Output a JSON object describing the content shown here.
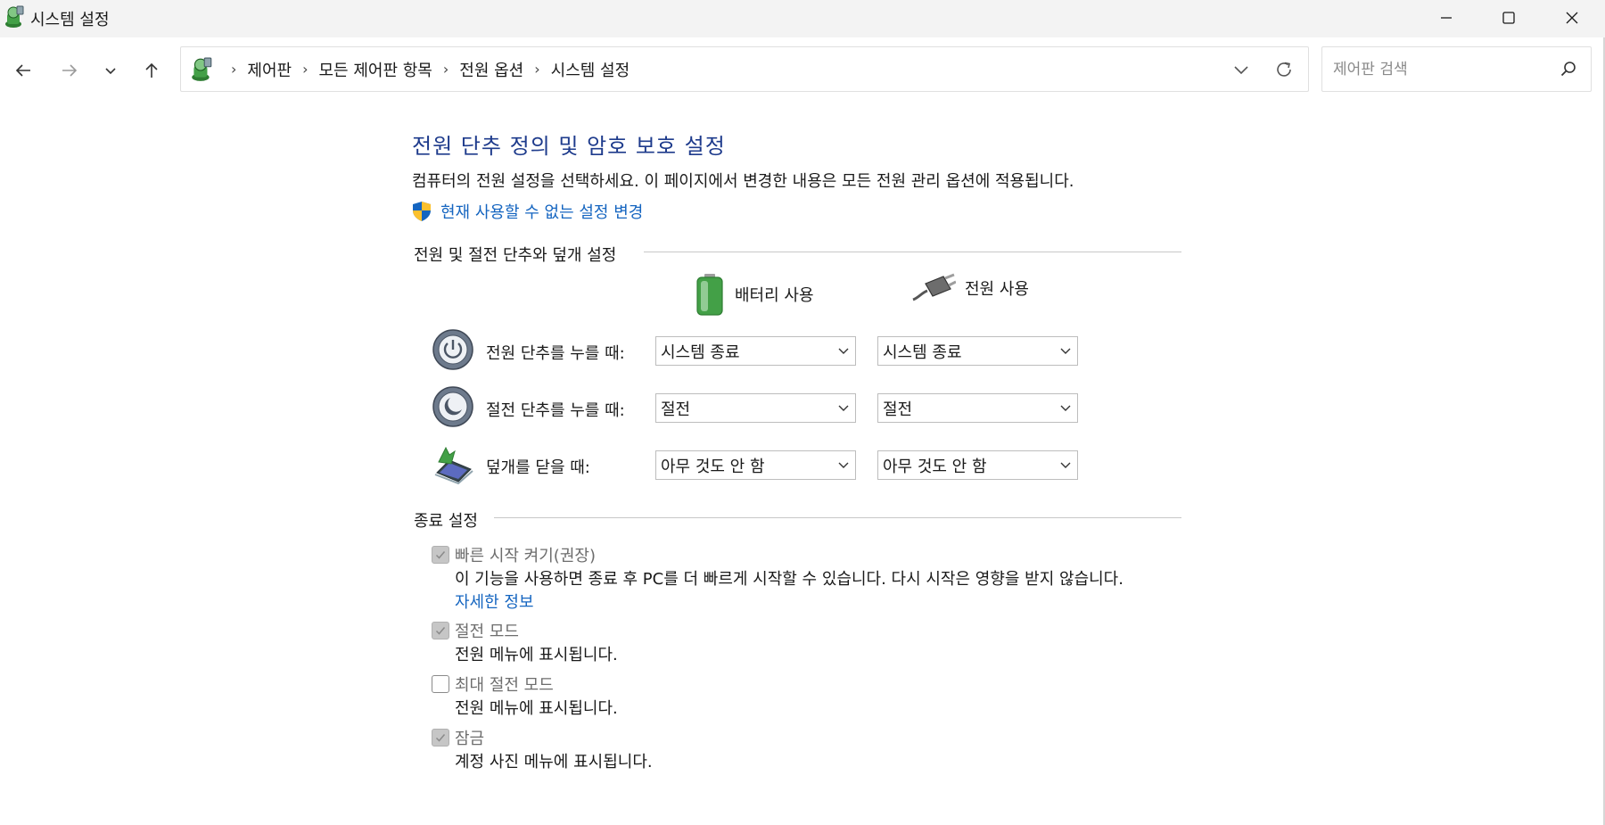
{
  "window": {
    "title": "시스템 설정"
  },
  "breadcrumb": [
    "제어판",
    "모든 제어판 항목",
    "전원 옵션",
    "시스템 설정"
  ],
  "search": {
    "placeholder": "제어판 검색"
  },
  "page": {
    "title": "전원 단추 정의 및 암호 보호 설정",
    "description": "컴퓨터의 전원 설정을 선택하세요. 이 페이지에서 변경한 내용은 모든 전원 관리 옵션에 적용됩니다.",
    "uac_link": "현재 사용할 수 없는 설정 변경"
  },
  "buttons_section": {
    "header": "전원 및 절전 단추와 덮개 설정",
    "col_battery": "배터리 사용",
    "col_plugged": "전원 사용",
    "rows": [
      {
        "label": "전원 단추를 누를 때:",
        "battery": "시스템 종료",
        "plugged": "시스템 종료",
        "icon": "power-button-icon"
      },
      {
        "label": "절전 단추를 누를 때:",
        "battery": "절전",
        "plugged": "절전",
        "icon": "sleep-button-icon"
      },
      {
        "label": "덮개를 닫을 때:",
        "battery": "아무 것도 안 함",
        "plugged": "아무 것도 안 함",
        "icon": "laptop-lid-icon"
      }
    ]
  },
  "shutdown_section": {
    "header": "종료 설정",
    "options": [
      {
        "label": "빠른 시작 켜기(권장)",
        "checked": true,
        "description": "이 기능을 사용하면 종료 후 PC를 더 빠르게 시작할 수 있습니다. 다시 시작은 영향을 받지 않습니다.",
        "link": "자세한 정보"
      },
      {
        "label": "절전 모드",
        "checked": true,
        "description": "전원 메뉴에 표시됩니다."
      },
      {
        "label": "최대 절전 모드",
        "checked": false,
        "description": "전원 메뉴에 표시됩니다."
      },
      {
        "label": "잠금",
        "checked": true,
        "description": "계정 사진 메뉴에 표시됩니다."
      }
    ]
  },
  "colors": {
    "title_blue": "#1e3b8c",
    "link_blue": "#1565c0",
    "titlebar_bg": "#f3f3f3"
  }
}
